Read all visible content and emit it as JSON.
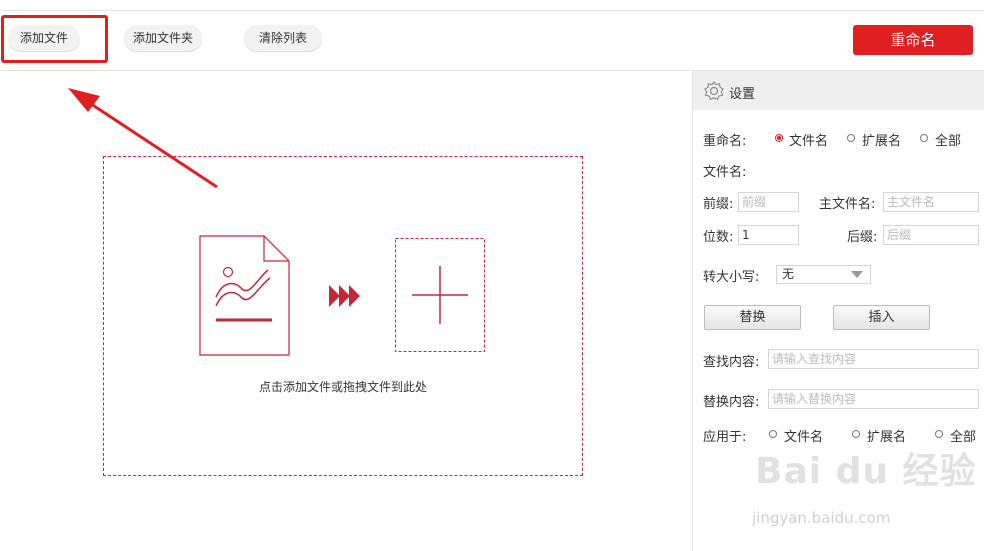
{
  "toolbar": {
    "add_file": "添加文件",
    "add_folder": "添加文件夹",
    "clear_list": "清除列表",
    "rename": "重命名"
  },
  "dropzone": {
    "hint": "点击添加文件或拖拽文件到此处"
  },
  "settings": {
    "title": "设置",
    "rename_label": "重命名:",
    "rename_options": [
      "文件名",
      "扩展名",
      "全部"
    ],
    "rename_selected": "文件名",
    "filename_label": "文件名:",
    "prefix_label": "前缀:",
    "prefix_placeholder": "前缀",
    "main_name_label": "主文件名:",
    "main_name_placeholder": "主文件名",
    "digits_label": "位数:",
    "digits_value": "1",
    "suffix_label": "后缀:",
    "suffix_placeholder": "后缀",
    "case_label": "转大小写:",
    "case_value": "无",
    "replace_button": "替换",
    "insert_button": "插入",
    "find_label": "查找内容:",
    "find_placeholder": "请输入查找内容",
    "replace_label": "替换内容:",
    "replace_placeholder": "请输入替换内容",
    "apply_label": "应用于:",
    "apply_options": [
      "文件名",
      "扩展名",
      "全部"
    ]
  },
  "watermark": {
    "brand": "Bai du 经验",
    "url": "jingyan.baidu.com"
  },
  "colors": {
    "accent": "#e02020",
    "dashed": "#c0293a"
  }
}
